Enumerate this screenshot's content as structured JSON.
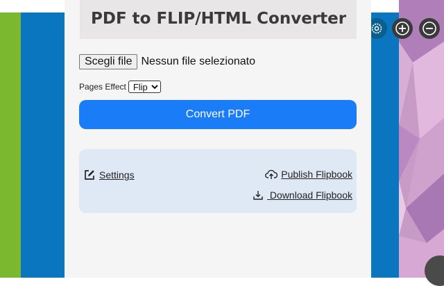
{
  "header": {
    "title": "PDF to FLIP/HTML Converter"
  },
  "file_input": {
    "button_label": "Scegli file",
    "status": "Nessun file selezionato"
  },
  "pages_effect": {
    "label": "Pages Effect",
    "selected": "Flip"
  },
  "convert": {
    "label": "Convert PDF"
  },
  "actions": {
    "settings": {
      "label": "Settings",
      "icon": "edit-icon"
    },
    "publish": {
      "label": "Publish Flipbook",
      "icon": "cloud-upload-icon"
    },
    "download": {
      "label": " Download Flipbook",
      "icon": "download-icon"
    }
  },
  "background_toolbar": {
    "icons": [
      "settings-gear-icon",
      "zoom-in-icon",
      "zoom-out-icon"
    ]
  },
  "colors": {
    "accent": "#1a7cf7",
    "panel_bg": "#f5f5f5",
    "header_bg": "#e8e6e6",
    "actions_bg": "#dfe9f5",
    "bg_blue": "#0a76bf",
    "bg_green": "#7cb82f"
  }
}
